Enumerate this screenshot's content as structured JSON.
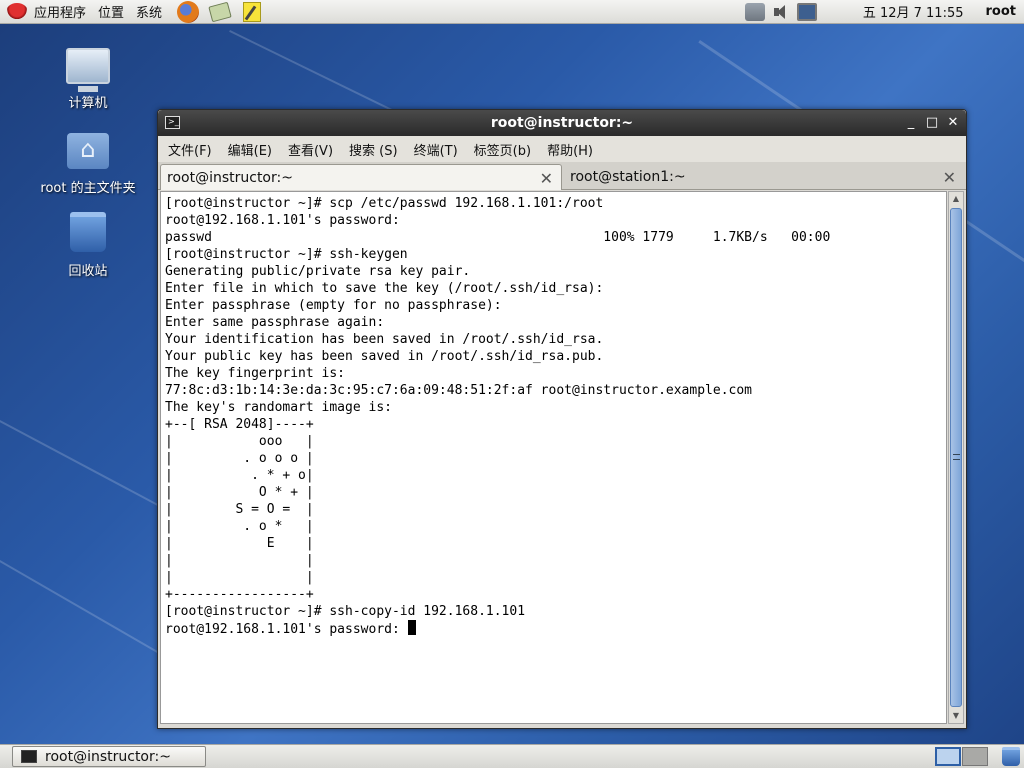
{
  "top_panel": {
    "menus": [
      "应用程序",
      "位置",
      "系统"
    ],
    "clock": "五 12月  7 11:55",
    "user": "root"
  },
  "desktop": {
    "icons": [
      {
        "label": "计算机",
        "icon": "computer-icon"
      },
      {
        "label": "root 的主文件夹",
        "icon": "home-folder-icon"
      },
      {
        "label": "回收站",
        "icon": "trash-icon"
      }
    ]
  },
  "window": {
    "title": "root@instructor:~",
    "menu": [
      "文件(F)",
      "编辑(E)",
      "查看(V)",
      "搜索 (S)",
      "终端(T)",
      "标签页(b)",
      "帮助(H)"
    ],
    "tabs": [
      {
        "label": "root@instructor:~",
        "active": true
      },
      {
        "label": "root@station1:~",
        "active": false
      }
    ],
    "terminal_lines": [
      "[root@instructor ~]# scp /etc/passwd 192.168.1.101:/root",
      "root@192.168.1.101's password:",
      "passwd                                                  100% 1779     1.7KB/s   00:00",
      "[root@instructor ~]# ssh-keygen",
      "Generating public/private rsa key pair.",
      "Enter file in which to save the key (/root/.ssh/id_rsa):",
      "Enter passphrase (empty for no passphrase):",
      "Enter same passphrase again:",
      "Your identification has been saved in /root/.ssh/id_rsa.",
      "Your public key has been saved in /root/.ssh/id_rsa.pub.",
      "The key fingerprint is:",
      "77:8c:d3:1b:14:3e:da:3c:95:c7:6a:09:48:51:2f:af root@instructor.example.com",
      "The key's randomart image is:",
      "+--[ RSA 2048]----+",
      "|           ooo   |",
      "|         . o o o |",
      "|          . * + o|",
      "|           O * + |",
      "|        S = O =  |",
      "|         . o *   |",
      "|            E    |",
      "|                 |",
      "|                 |",
      "+-----------------+",
      "[root@instructor ~]# ssh-copy-id 192.168.1.101"
    ],
    "prompt_line": "root@192.168.1.101's password: "
  },
  "bottom_panel": {
    "task_label": "root@instructor:~"
  }
}
